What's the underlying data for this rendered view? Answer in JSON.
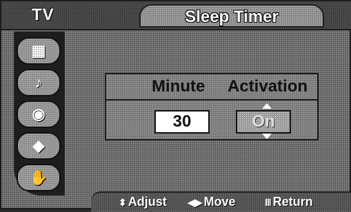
{
  "header": {
    "source_label": "TV",
    "title": "Sleep Timer"
  },
  "side_menu": {
    "items": [
      {
        "icon": "picture-icon"
      },
      {
        "icon": "sound-icon"
      },
      {
        "icon": "channel-icon"
      },
      {
        "icon": "setup-icon"
      },
      {
        "icon": "input-icon"
      }
    ]
  },
  "panel": {
    "minute_label": "Minute",
    "activation_label": "Activation",
    "minute_value": "30",
    "activation_value": "On"
  },
  "footer": {
    "adjust_label": "Adjust",
    "move_label": "Move",
    "return_label": "Return"
  }
}
